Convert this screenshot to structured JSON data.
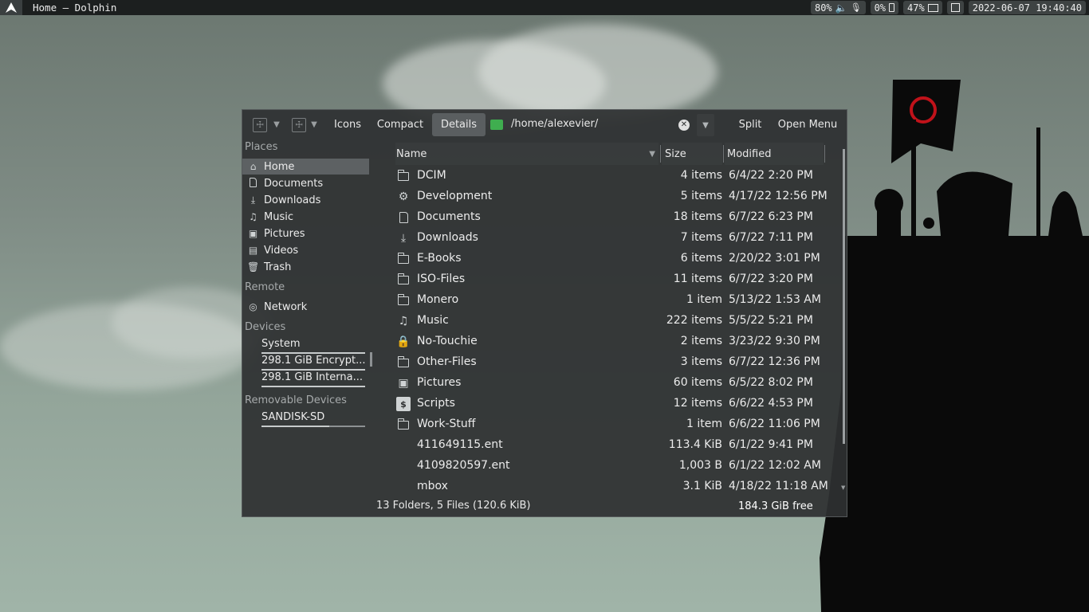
{
  "topbar": {
    "window_title": "Home — Dolphin",
    "volume": "80%",
    "brightness": "0%",
    "battery": "47%",
    "datetime": "2022-06-07 19:40:40"
  },
  "toolbar": {
    "view_icons": "Icons",
    "view_compact": "Compact",
    "view_details": "Details",
    "path": "/home/alexevier/",
    "split": "Split",
    "open_menu": "Open Menu"
  },
  "sidebar": {
    "places_header": "Places",
    "places": [
      {
        "label": "Home",
        "icon": "home-icon"
      },
      {
        "label": "Documents",
        "icon": "document-icon"
      },
      {
        "label": "Downloads",
        "icon": "download-icon"
      },
      {
        "label": "Music",
        "icon": "music-icon"
      },
      {
        "label": "Pictures",
        "icon": "picture-icon"
      },
      {
        "label": "Videos",
        "icon": "video-icon"
      },
      {
        "label": "Trash",
        "icon": "trash-icon"
      }
    ],
    "remote_header": "Remote",
    "remote": [
      {
        "label": "Network",
        "icon": "network-icon"
      }
    ],
    "devices_header": "Devices",
    "devices": [
      {
        "label": "System",
        "usage": 1.0
      },
      {
        "label": "298.1 GiB Encrypt...",
        "usage": 1.0
      },
      {
        "label": "298.1 GiB Interna...",
        "usage": 1.0
      }
    ],
    "removable_header": "Removable Devices",
    "removable": [
      {
        "label": "SANDISK-SD",
        "usage": 0.65
      }
    ]
  },
  "columns": {
    "name": "Name",
    "size": "Size",
    "modified": "Modified"
  },
  "files": [
    {
      "name": "DCIM",
      "size": "4 items",
      "modified": "6/4/22 2:20 PM",
      "icon": "folder-icon"
    },
    {
      "name": "Development",
      "size": "5 items",
      "modified": "4/17/22 12:56 PM",
      "icon": "gear-icon"
    },
    {
      "name": "Documents",
      "size": "18 items",
      "modified": "6/7/22 6:23 PM",
      "icon": "document-icon"
    },
    {
      "name": "Downloads",
      "size": "7 items",
      "modified": "6/7/22 7:11 PM",
      "icon": "download-icon"
    },
    {
      "name": "E-Books",
      "size": "6 items",
      "modified": "2/20/22 3:01 PM",
      "icon": "folder-icon"
    },
    {
      "name": "ISO-Files",
      "size": "11 items",
      "modified": "6/7/22 3:20 PM",
      "icon": "folder-icon"
    },
    {
      "name": "Monero",
      "size": "1 item",
      "modified": "5/13/22 1:53 AM",
      "icon": "folder-icon"
    },
    {
      "name": "Music",
      "size": "222 items",
      "modified": "5/5/22 5:21 PM",
      "icon": "music-icon"
    },
    {
      "name": "No-Touchie",
      "size": "2 items",
      "modified": "3/23/22 9:30 PM",
      "icon": "lock-icon"
    },
    {
      "name": "Other-Files",
      "size": "3 items",
      "modified": "6/7/22 12:36 PM",
      "icon": "folder-icon"
    },
    {
      "name": "Pictures",
      "size": "60 items",
      "modified": "6/5/22 8:02 PM",
      "icon": "picture-icon"
    },
    {
      "name": "Scripts",
      "size": "12 items",
      "modified": "6/6/22 4:53 PM",
      "icon": "terminal-icon"
    },
    {
      "name": "Work-Stuff",
      "size": "1 item",
      "modified": "6/6/22 11:06 PM",
      "icon": "folder-icon"
    },
    {
      "name": "411649115.ent",
      "size": "113.4 KiB",
      "modified": "6/1/22 9:41 PM",
      "icon": ""
    },
    {
      "name": "4109820597.ent",
      "size": "1,003 B",
      "modified": "6/1/22 12:02 AM",
      "icon": ""
    },
    {
      "name": "mbox",
      "size": "3.1 KiB",
      "modified": "4/18/22 11:18 AM",
      "icon": ""
    }
  ],
  "status": {
    "summary": "13 Folders, 5 Files (120.6 KiB)",
    "free": "184.3 GiB free"
  }
}
